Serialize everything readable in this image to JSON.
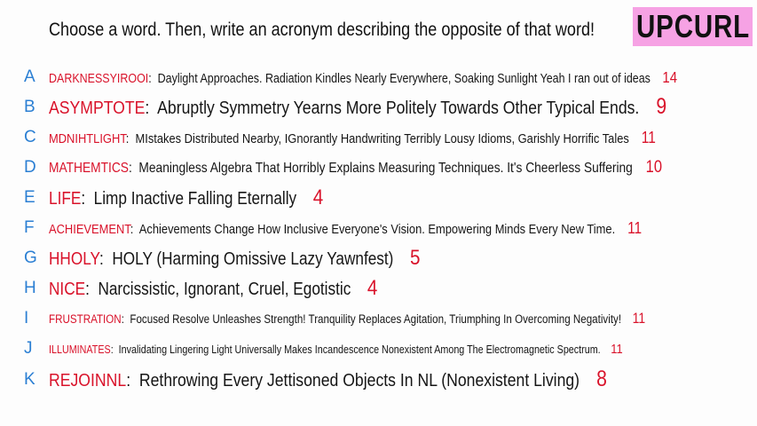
{
  "title": "Choose a word. Then, write an acronym describing the opposite of that word!",
  "badge": "UPCURL",
  "colors": {
    "letter": "#2b7fd3",
    "word": "#d9122a",
    "badge_bg": "#f6a2e4"
  },
  "rows": [
    {
      "letter": "A",
      "word": "DARKNESSYIROOI",
      "acronym": "Daylight Approaches. Radiation Kindles Nearly Everywhere, Soaking Sunlight Yeah I ran out of ideas",
      "score": "14"
    },
    {
      "letter": "B",
      "word": "ASYMPTOTE",
      "acronym": "Abruptly Symmetry Yearns More Politely Towards Other Typical Ends.",
      "score": "9"
    },
    {
      "letter": "C",
      "word": "MDNIHTLIGHT",
      "acronym": "MIstakes Distributed Nearby, IGnorantly Handwriting Terribly Lousy Idioms, Garishly Horrific Tales",
      "score": "11"
    },
    {
      "letter": "D",
      "word": "MATHEMTICS",
      "acronym": "Meaningless Algebra That Horribly Explains Measuring Techniques. It's Cheerless Suffering",
      "score": "10"
    },
    {
      "letter": "E",
      "word": "LIFE",
      "acronym": "Limp Inactive Falling Eternally",
      "score": "4"
    },
    {
      "letter": "F",
      "word": "ACHIEVEMENT",
      "acronym": "Achievements Change How Inclusive Everyone's Vision. Empowering Minds Every New Time.",
      "score": "11"
    },
    {
      "letter": "G",
      "word": "HHOLY",
      "acronym": "HOLY (Harming Omissive Lazy Yawnfest)",
      "score": "5"
    },
    {
      "letter": "H",
      "word": "NICE",
      "acronym": "Narcissistic, Ignorant, Cruel, Egotistic",
      "score": "4"
    },
    {
      "letter": "I",
      "word": "FRUSTRATION",
      "acronym": "Focused Resolve Unleashes Strength! Tranquility Replaces Agitation, Triumphing In Overcoming Negativity!",
      "score": "11"
    },
    {
      "letter": "J",
      "word": "ILLUMINATES",
      "acronym": "Invalidating Lingering Light Universally Makes Incandescence Nonexistent Among The Electromagnetic Spectrum.",
      "score": "11"
    },
    {
      "letter": "K",
      "word": "REJOINNL",
      "acronym": "Rethrowing Every Jettisoned Objects In NL (Nonexistent Living)",
      "score": "8"
    }
  ]
}
